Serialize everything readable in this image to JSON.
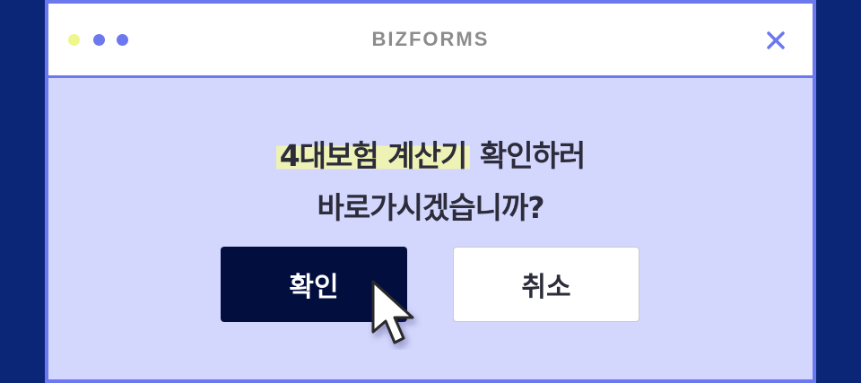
{
  "app": {
    "title": "BIZFORMS"
  },
  "dialog": {
    "question_highlight": "4대보험 계산기",
    "question_line1_rest": "확인하러",
    "question_line2": "바로가시겠습니까?",
    "confirm_label": "확인",
    "cancel_label": "취소"
  },
  "icons": {
    "close": "close-icon",
    "cursor": "mouse-pointer-icon"
  },
  "colors": {
    "background": "#0b2677",
    "window_border": "#6c78ee",
    "content_bg": "#d4d7fd",
    "dot_yellow": "#eef78b",
    "dot_blue": "#6c78ee",
    "highlight": "#eef2b4",
    "confirm_button": "#020e3e",
    "cancel_button": "#ffffff"
  }
}
